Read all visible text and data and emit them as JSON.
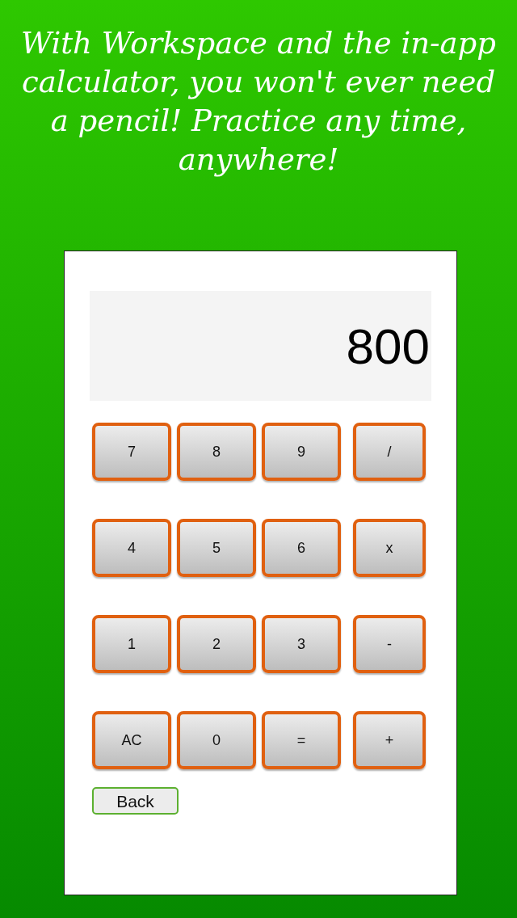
{
  "caption": "With Workspace and the in-app calculator, you won't ever need a pencil! Practice any time, anywhere!",
  "display": {
    "value": "800"
  },
  "keys": [
    [
      "7",
      "8",
      "9",
      "/"
    ],
    [
      "4",
      "5",
      "6",
      "x"
    ],
    [
      "1",
      "2",
      "3",
      "-"
    ],
    [
      "AC",
      "0",
      "=",
      "+"
    ]
  ],
  "back_button": {
    "label": "Back"
  }
}
